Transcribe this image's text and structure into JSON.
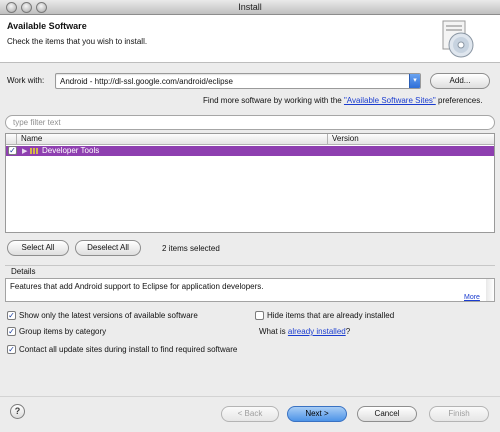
{
  "window": {
    "title": "Install"
  },
  "header": {
    "title": "Available Software",
    "subtitle": "Check the items that you wish to install."
  },
  "work_with": {
    "label": "Work with:",
    "value": "Android - http://dl-ssl.google.com/android/eclipse",
    "add_label": "Add...",
    "more_prefix": "Find more software by working with the ",
    "more_link": "\"Available Software Sites\"",
    "more_suffix": " preferences."
  },
  "filter": {
    "placeholder": "type filter text"
  },
  "table": {
    "columns": [
      "Name",
      "Version"
    ],
    "rows": [
      {
        "checked": true,
        "label": "Developer Tools",
        "version": "",
        "selected": true
      }
    ]
  },
  "selection": {
    "select_all": "Select All",
    "deselect_all": "Deselect All",
    "count_text": "2 items selected"
  },
  "details": {
    "label": "Details",
    "text": "Features that add Android support to Eclipse for application developers.",
    "more": "More"
  },
  "options": {
    "show_latest": {
      "label": "Show only the latest versions of available software",
      "checked": true
    },
    "hide_installed": {
      "label": "Hide items that are already installed",
      "checked": false
    },
    "group_by_category": {
      "label": "Group items by category",
      "checked": true
    },
    "what_is_prefix": "What is ",
    "what_is_link": "already installed",
    "what_is_suffix": "?",
    "contact_sites": {
      "label": "Contact all update sites during install to find required software",
      "checked": true
    }
  },
  "footer": {
    "back": "< Back",
    "next": "Next >",
    "cancel": "Cancel",
    "finish": "Finish",
    "help": "?"
  },
  "colors": {
    "selection_row": "#8e3fb0",
    "default_button": "#4d94e8",
    "link": "#1a3ccf"
  }
}
